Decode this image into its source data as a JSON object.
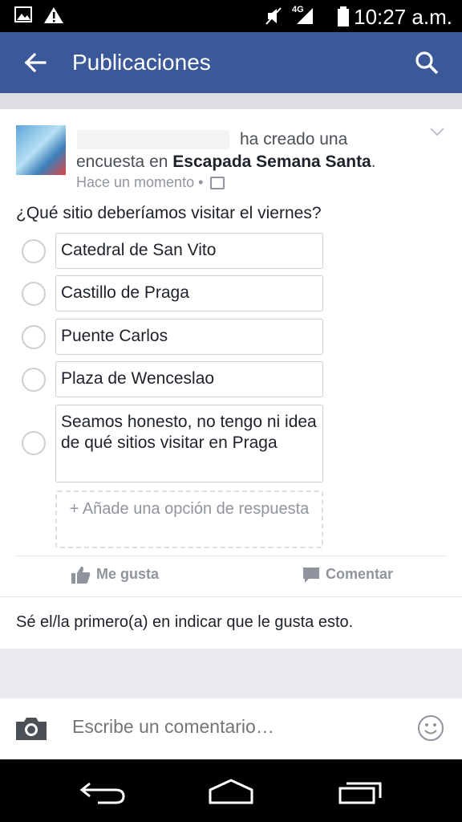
{
  "status_bar": {
    "time": "10:27 a.m.",
    "network": "4G",
    "icons": [
      "image-icon",
      "warning-icon",
      "mute-icon",
      "signal-icon",
      "battery-icon"
    ]
  },
  "app_bar": {
    "title": "Publicaciones",
    "color": "#3b5998",
    "icons": [
      "back-arrow-icon",
      "search-icon"
    ]
  },
  "post": {
    "headline_action": "ha creado una",
    "headline_rest": "encuesta en",
    "group_name": "Escapada Semana Santa",
    "headline_end": ".",
    "timestamp": "Hace un momento",
    "separator": "•",
    "privacy_icon": "group-privacy-icon",
    "question": "¿Qué sitio deberíamos visitar el viernes?",
    "options": [
      "Catedral de San Vito",
      "Castillo de Praga",
      "Puente Carlos",
      "Plaza de Wenceslao",
      "Seamos honesto, no tengo ni idea de qué sitios visitar en Praga"
    ],
    "add_option_label": "+ Añade una opción de respuesta",
    "actions": {
      "like": "Me gusta",
      "comment": "Comentar"
    },
    "likes_summary": "Sé el/la primero(a) en indicar que le gusta esto."
  },
  "comment_bar": {
    "placeholder": "Escribe un comentario…"
  },
  "nav_bar": {
    "icons": [
      "back-nav-icon",
      "home-nav-icon",
      "recents-nav-icon"
    ]
  }
}
